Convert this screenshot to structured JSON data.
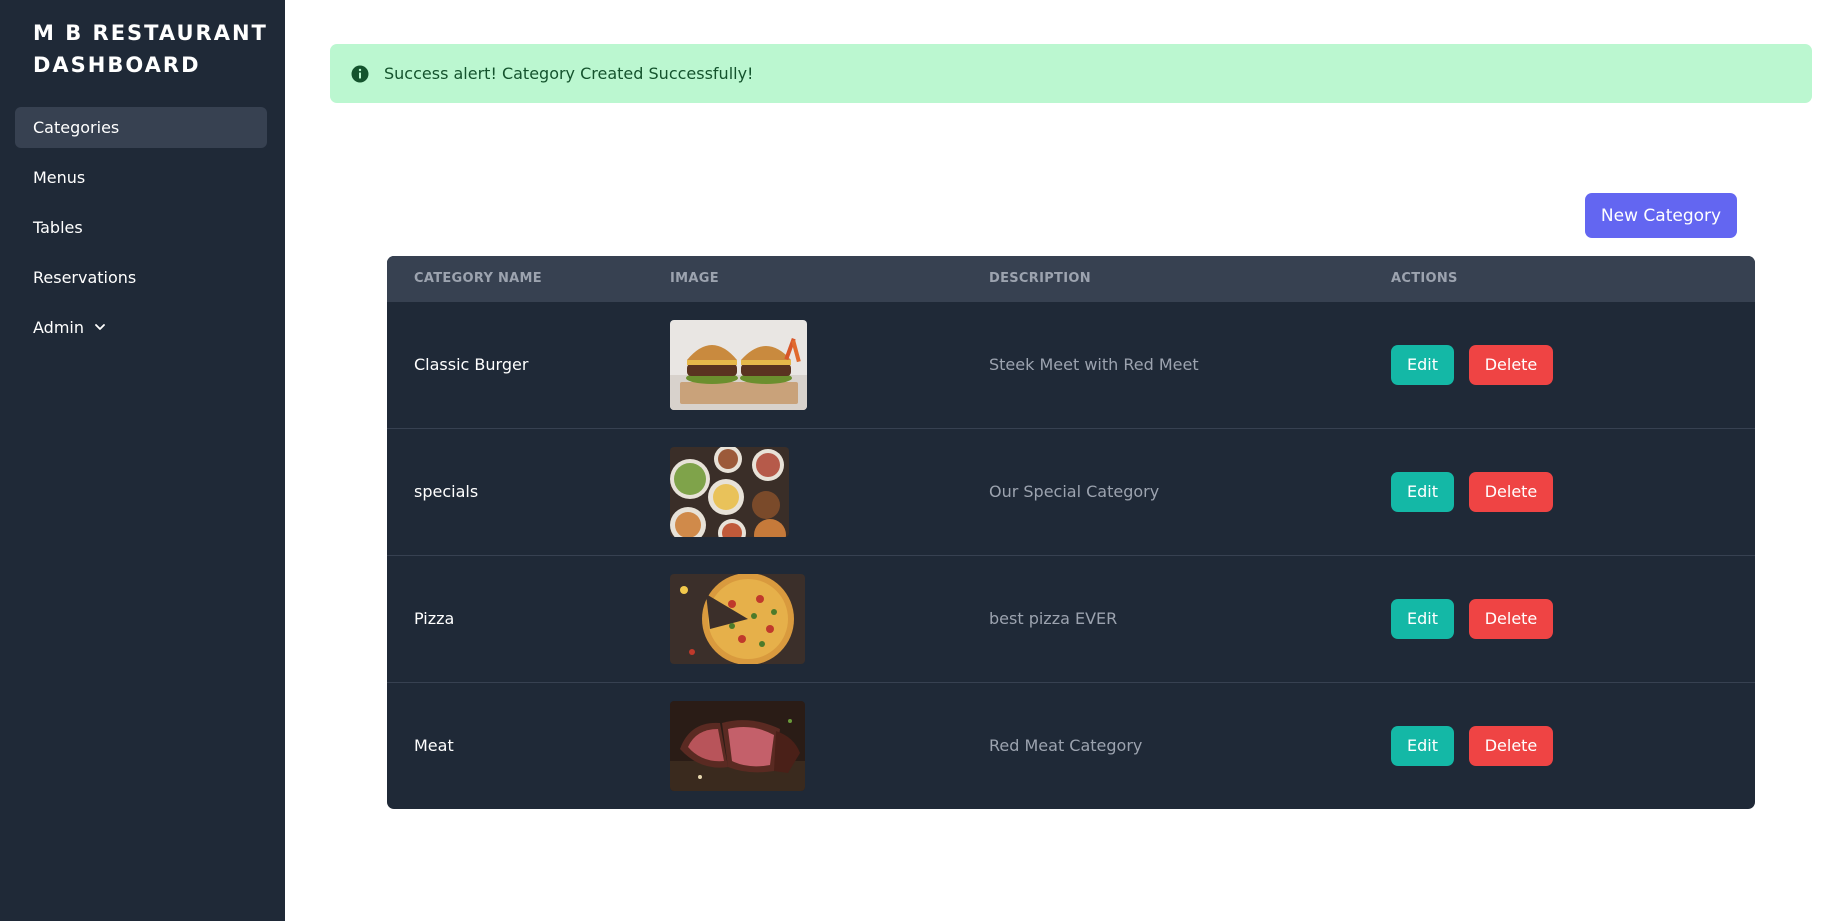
{
  "sidebar": {
    "brand_line1": "M B RESTAURANT",
    "brand_line2": "DASHBOARD",
    "items": [
      {
        "label": "Categories"
      },
      {
        "label": "Menus"
      },
      {
        "label": "Tables"
      },
      {
        "label": "Reservations"
      },
      {
        "label": "Admin"
      }
    ]
  },
  "alert": {
    "text": "Success alert! Category Created Successfully!",
    "icon": "info-icon"
  },
  "actions": {
    "new_category_label": "New Category"
  },
  "table": {
    "headers": [
      "CATEGORY NAME",
      "IMAGE",
      "DESCRIPTION",
      "ACTIONS"
    ],
    "rows": [
      {
        "name": "Classic Burger",
        "description": "Steek Meet with Red Meet",
        "edit_label": "Edit",
        "delete_label": "Delete",
        "image": "burger-photo"
      },
      {
        "name": "specials",
        "description": "Our Special Category",
        "edit_label": "Edit",
        "delete_label": "Delete",
        "image": "specials-photo"
      },
      {
        "name": "Pizza",
        "description": "best pizza EVER",
        "edit_label": "Edit",
        "delete_label": "Delete",
        "image": "pizza-photo"
      },
      {
        "name": "Meat",
        "description": "Red Meat Category",
        "edit_label": "Edit",
        "delete_label": "Delete",
        "image": "meat-photo"
      }
    ]
  },
  "colors": {
    "sidebar_bg": "#1f2937",
    "active_item_bg": "#374151",
    "alert_bg": "#bbf7d0",
    "primary_button": "#6366f1",
    "edit_button": "#14b8a6",
    "delete_button": "#ef4444"
  }
}
